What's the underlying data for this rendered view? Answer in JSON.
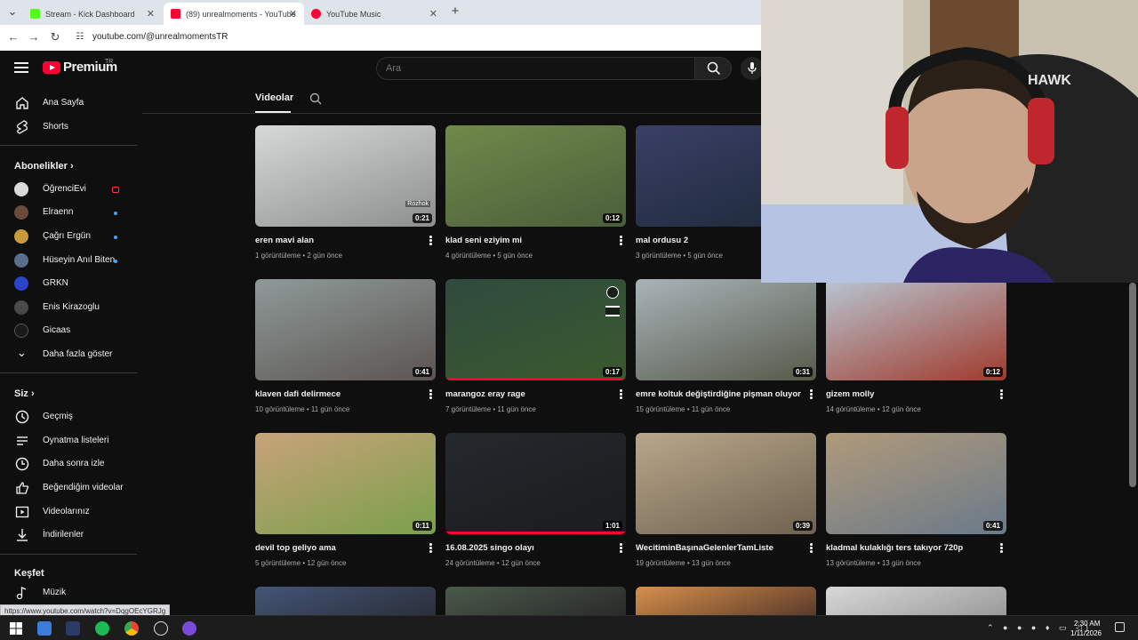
{
  "browser": {
    "tabs": [
      {
        "label": "Stream - Kick Dashboard",
        "favicon_color": "#53fc18"
      },
      {
        "label": "(89) unrealmoments - YouTube",
        "favicon_color": "#ff0033"
      },
      {
        "label": "YouTube Music",
        "favicon_color": "#ff0033"
      }
    ],
    "new_tab": "+",
    "url": "youtube.com/@unrealmomentsTR"
  },
  "header": {
    "logo_text": "Premium",
    "logo_region": "TR",
    "search_placeholder": "Ara"
  },
  "sidebar": {
    "main": [
      {
        "label": "Ana Sayfa",
        "icon": "home-icon"
      },
      {
        "label": "Shorts",
        "icon": "shorts-icon"
      }
    ],
    "subscriptions_heading": "Abonelikler",
    "subscriptions": [
      {
        "label": "ÖğrenciEvi",
        "avatar_color": "#d9d9d9",
        "indicator": "live"
      },
      {
        "label": "Elraenn",
        "avatar_color": "#6b4a3a",
        "indicator": "new"
      },
      {
        "label": "Çağrı Ergün",
        "avatar_color": "#c89a3a",
        "indicator": "new"
      },
      {
        "label": "Hüseyin Anıl Biten",
        "avatar_color": "#5a6d8c",
        "indicator": "new"
      },
      {
        "label": "GRKN",
        "avatar_color": "#2a44c8",
        "indicator": ""
      },
      {
        "label": "Enis Kirazoglu",
        "avatar_color": "#4a4a4a",
        "indicator": ""
      },
      {
        "label": "Gicaas",
        "avatar_color": "#1a1a1a",
        "indicator": ""
      },
      {
        "label": "Daha fazla göster",
        "avatar_color": "",
        "indicator": ""
      }
    ],
    "you_heading": "Siz",
    "you": [
      {
        "label": "Geçmiş",
        "icon": "history-icon"
      },
      {
        "label": "Oynatma listeleri",
        "icon": "playlists-icon"
      },
      {
        "label": "Daha sonra izle",
        "icon": "watch-later-icon"
      },
      {
        "label": "Beğendiğim videolar",
        "icon": "like-icon"
      },
      {
        "label": "Videolarınız",
        "icon": "your-videos-icon"
      },
      {
        "label": "İndirilenler",
        "icon": "download-icon"
      }
    ],
    "explore_heading": "Keşfet",
    "explore": [
      {
        "label": "Müzik",
        "icon": "music-icon"
      }
    ]
  },
  "channel_tabs": {
    "active": "Videolar"
  },
  "videos": [
    {
      "title": "eren mavi alan",
      "views": "1 görüntüleme",
      "age": "2 gün önce",
      "duration": "0:21",
      "colors": [
        "#d7d9d8",
        "#8c8f8e"
      ],
      "progress": 0
    },
    {
      "title": "klad seni eziyim mi",
      "views": "4 görüntüleme",
      "age": "5 gün önce",
      "duration": "0:12",
      "colors": [
        "#6f8a4a",
        "#4b5e3a"
      ],
      "progress": 0
    },
    {
      "title": "mal ordusu 2",
      "views": "3 görüntüleme",
      "age": "5 gün önce",
      "duration": "",
      "colors": [
        "#3b3f66",
        "#1d2a3a"
      ],
      "progress": 0
    },
    {
      "title": "",
      "views": "",
      "age": "",
      "duration": "",
      "colors": [
        "#0f0f0f",
        "#0f0f0f"
      ],
      "progress": 0
    },
    {
      "title": "klaven dafi delirmece",
      "views": "10 görüntüleme",
      "age": "11 gün önce",
      "duration": "0:41",
      "colors": [
        "#8e9a98",
        "#5c5553"
      ],
      "progress": 0
    },
    {
      "title": "marangoz eray rage",
      "views": "7 görüntüleme",
      "age": "11 gün önce",
      "duration": "0:17",
      "colors": [
        "#2f4a3e",
        "#3a5a2e"
      ],
      "progress": 1
    },
    {
      "title": "emre koltuk değiştirdiğine pişman oluyor",
      "views": "15 görüntüleme",
      "age": "11 gün önce",
      "duration": "0:31",
      "colors": [
        "#a9b3b8",
        "#565a4a"
      ],
      "progress": 0
    },
    {
      "title": "gizem molly",
      "views": "14 görüntüleme",
      "age": "12 gün önce",
      "duration": "0:12",
      "colors": [
        "#b7c6d2",
        "#a03a2c"
      ],
      "progress": 0
    },
    {
      "title": "devil top geliyo ama",
      "views": "5 görüntüleme",
      "age": "12 gün önce",
      "duration": "0:11",
      "colors": [
        "#c8a27a",
        "#7aa04a"
      ],
      "progress": 0
    },
    {
      "title": "16.08.2025 singo olayı",
      "views": "24 görüntüleme",
      "age": "12 gün önce",
      "duration": "1:01",
      "colors": [
        "#25282c",
        "#1a1c1f"
      ],
      "progress": 1
    },
    {
      "title": "WecitiminBaşınaGelenlerTamListe",
      "views": "19 görüntüleme",
      "age": "13 gün önce",
      "duration": "0:39",
      "colors": [
        "#b8a78a",
        "#6f6150"
      ],
      "progress": 0
    },
    {
      "title": "kladmal kulaklığı ters takıyor 720p",
      "views": "13 görüntüleme",
      "age": "13 gün önce",
      "duration": "0:41",
      "colors": [
        "#b09a7a",
        "#6a7a8a"
      ],
      "progress": 0
    },
    {
      "title": "",
      "views": "",
      "age": "",
      "duration": "",
      "colors": [
        "#445577",
        "#2a2f3a"
      ],
      "progress": 0
    },
    {
      "title": "",
      "views": "",
      "age": "",
      "duration": "",
      "colors": [
        "#4a5a4a",
        "#2a2a2a"
      ],
      "progress": 0
    },
    {
      "title": "",
      "views": "",
      "age": "",
      "duration": "",
      "colors": [
        "#d6904a",
        "#5a3a2a"
      ],
      "progress": 0
    },
    {
      "title": "",
      "views": "",
      "age": "",
      "duration": "",
      "colors": [
        "#d8d8d8",
        "#9a9a9a"
      ],
      "progress": 0
    }
  ],
  "thumb_overlay_text": "Rozhok",
  "status_link": "https://www.youtube.com/watch?v=DqgOEcYGRJg",
  "taskbar": {
    "time": "2:30 AM",
    "date": "1/11/2026"
  }
}
